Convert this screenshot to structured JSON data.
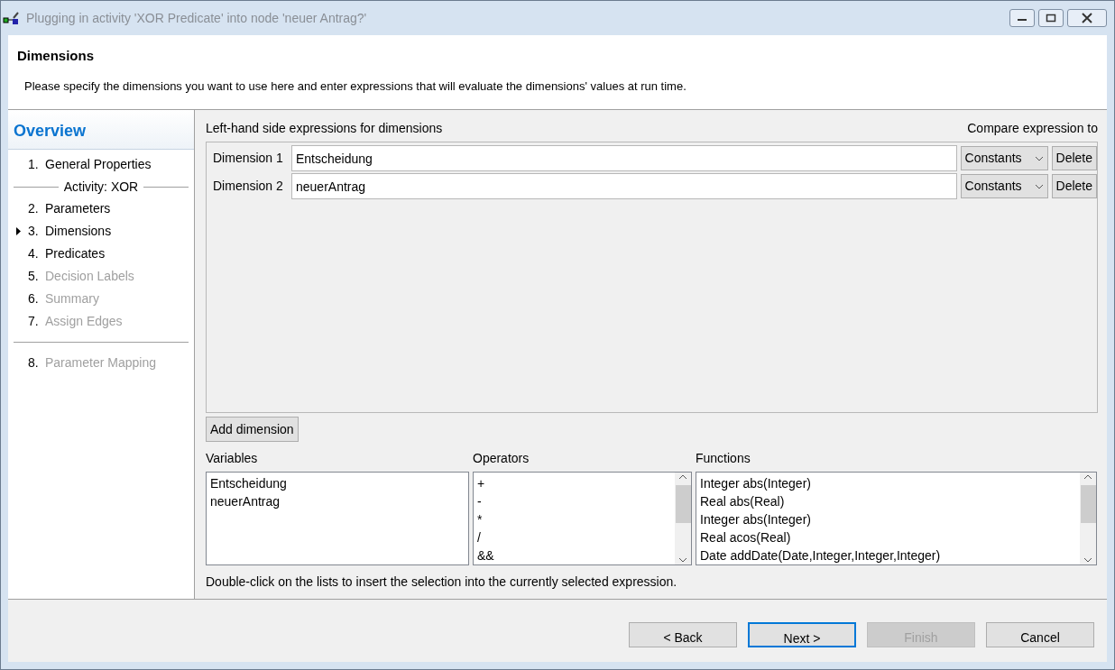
{
  "window": {
    "title": "Plugging in activity 'XOR Predicate' into node 'neuer Antrag?'"
  },
  "header": {
    "title": "Dimensions",
    "description": "Please specify the dimensions you want to use here and enter expressions that will evaluate the dimensions' values at run time."
  },
  "sidebar": {
    "title": "Overview",
    "items": [
      {
        "kind": "step",
        "number": "1.",
        "label": "General Properties",
        "disabled": false,
        "selected": false
      },
      {
        "kind": "section",
        "label": "Activity: XOR"
      },
      {
        "kind": "step",
        "number": "2.",
        "label": "Parameters",
        "disabled": false,
        "selected": false
      },
      {
        "kind": "step",
        "number": "3.",
        "label": "Dimensions",
        "disabled": false,
        "selected": true
      },
      {
        "kind": "step",
        "number": "4.",
        "label": "Predicates",
        "disabled": false,
        "selected": false
      },
      {
        "kind": "step",
        "number": "5.",
        "label": "Decision Labels",
        "disabled": true,
        "selected": false
      },
      {
        "kind": "step",
        "number": "6.",
        "label": "Summary",
        "disabled": true,
        "selected": false
      },
      {
        "kind": "step",
        "number": "7.",
        "label": "Assign Edges",
        "disabled": true,
        "selected": false
      },
      {
        "kind": "rule"
      },
      {
        "kind": "step",
        "number": "8.",
        "label": "Parameter Mapping",
        "disabled": true,
        "selected": false
      }
    ]
  },
  "dimensions": {
    "heading": "Left-hand side expressions for dimensions",
    "compare_heading": "Compare expression to",
    "rows": [
      {
        "label": "Dimension 1",
        "value": "Entscheidung",
        "compare": "Constants",
        "delete": "Delete"
      },
      {
        "label": "Dimension 2",
        "value": "neuerAntrag",
        "compare": "Constants",
        "delete": "Delete"
      }
    ],
    "add_button": "Add dimension"
  },
  "lists": [
    {
      "title": "Variables",
      "scrollbar": false,
      "items": [
        "Entscheidung",
        "neuerAntrag"
      ]
    },
    {
      "title": "Operators",
      "scrollbar": true,
      "items": [
        "+",
        "-",
        "*",
        "/",
        "&&"
      ]
    },
    {
      "title": "Functions",
      "scrollbar": true,
      "items": [
        "Integer abs(Integer)",
        "Real abs(Real)",
        "Integer abs(Integer)",
        "Real acos(Real)",
        "Date addDate(Date,Integer,Integer,Integer)"
      ]
    }
  ],
  "hint": "Double-click on the lists to insert the selection into the currently selected expression.",
  "buttons": [
    {
      "label": "< Back",
      "disabled": false,
      "default": false
    },
    {
      "label": "Next >",
      "disabled": false,
      "default": true
    },
    {
      "label": "Finish",
      "disabled": true,
      "default": false
    },
    {
      "label": "Cancel",
      "disabled": false,
      "default": false
    }
  ]
}
